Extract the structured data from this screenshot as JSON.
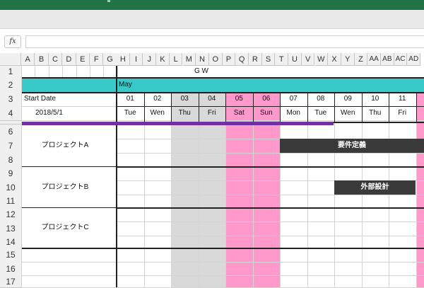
{
  "formula_bar": {
    "fx_label": "fx",
    "value": ""
  },
  "column_letters": [
    "A",
    "B",
    "C",
    "D",
    "E",
    "F",
    "G",
    "H",
    "I",
    "J",
    "K",
    "L",
    "M",
    "N",
    "O",
    "P",
    "Q",
    "R",
    "S",
    "T",
    "U",
    "V",
    "W",
    "X",
    "Y",
    "Z",
    "AA",
    "AB",
    "AC",
    "AD"
  ],
  "row_numbers": [
    "1",
    "2",
    "3",
    "4",
    "6",
    "7",
    "8",
    "9",
    "10",
    "11",
    "12",
    "13",
    "14",
    "15",
    "16",
    "17"
  ],
  "sheet": {
    "title": "G W",
    "month": "May",
    "start_date_label": "Start Date",
    "start_date_value": "2018/5/1",
    "days": [
      {
        "day": "01",
        "weekday": "Tue",
        "kind": "weekday"
      },
      {
        "day": "02",
        "weekday": "Wen",
        "kind": "weekday"
      },
      {
        "day": "03",
        "weekday": "Thu",
        "kind": "holiday"
      },
      {
        "day": "04",
        "weekday": "Fri",
        "kind": "holiday"
      },
      {
        "day": "05",
        "weekday": "Sat",
        "kind": "weekend"
      },
      {
        "day": "06",
        "weekday": "Sun",
        "kind": "weekend"
      },
      {
        "day": "07",
        "weekday": "Mon",
        "kind": "weekday"
      },
      {
        "day": "08",
        "weekday": "Tue",
        "kind": "weekday"
      },
      {
        "day": "09",
        "weekday": "Wen",
        "kind": "weekday"
      },
      {
        "day": "10",
        "weekday": "Thu",
        "kind": "weekday"
      },
      {
        "day": "11",
        "weekday": "Fri",
        "kind": "weekday"
      },
      {
        "day": "",
        "weekday": "",
        "kind": "weekend"
      }
    ],
    "projects": [
      {
        "name": "プロジェクトA",
        "task": "要件定義"
      },
      {
        "name": "プロジェクトB",
        "task": "外部設計"
      },
      {
        "name": "プロジェクトC",
        "task": ""
      }
    ],
    "colors": {
      "month_band": "#38c9c9",
      "holiday": "#d9d9d9",
      "weekend": "#ff99cc",
      "task_bar": "#3a3a3a",
      "progress_line": "#7030a0"
    }
  }
}
